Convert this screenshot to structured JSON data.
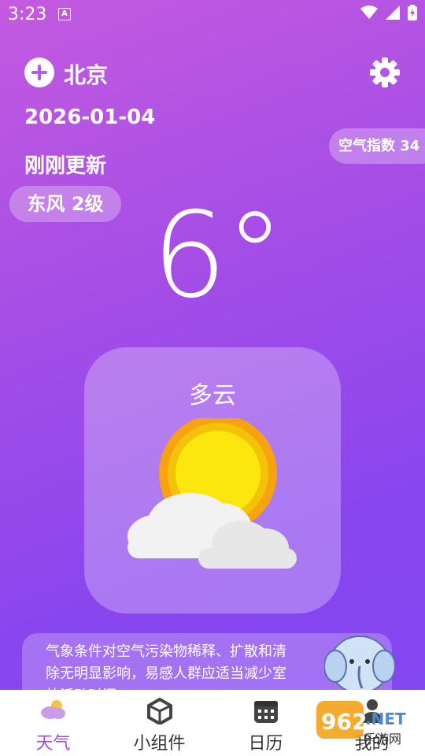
{
  "status": {
    "time": "3:23",
    "notification_icon": "A"
  },
  "header": {
    "city": "北京",
    "date": "2026-01-04",
    "update_status": "刚刚更新"
  },
  "air_quality": {
    "label": "空气指数 34"
  },
  "wind": {
    "label": "东风 2级"
  },
  "current": {
    "temperature": "6°",
    "condition": "多云",
    "icon": "partly-cloudy-icon"
  },
  "tip": {
    "text": "气象条件对空气污染物稀释、扩散和清除无明显影响，易感人群应适当减少室外活动时间"
  },
  "tabs": [
    {
      "label": "天气",
      "icon": "weather-icon",
      "active": true
    },
    {
      "label": "小组件",
      "icon": "widget-icon",
      "active": false
    },
    {
      "label": "日历",
      "icon": "calendar-icon",
      "active": false
    },
    {
      "label": "我的",
      "icon": "user-icon",
      "active": false
    }
  ],
  "watermark": {
    "text": "962.NET",
    "subtext": "乐游网"
  },
  "colors": {
    "accent": "#a44ee7",
    "gradient_top": "#c45ae0",
    "gradient_bottom": "#7f47f2"
  }
}
